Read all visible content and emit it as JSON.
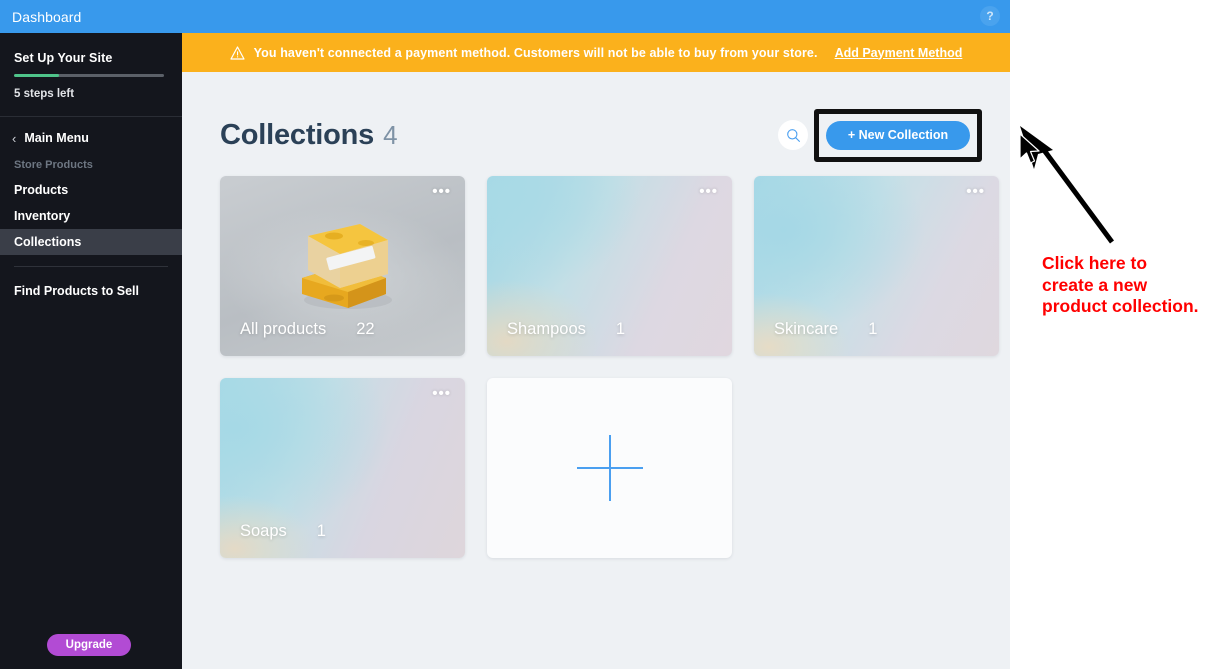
{
  "topbar": {
    "title": "Dashboard",
    "help_icon": "question-mark-icon",
    "help_label": "?",
    "background_color": "#3899ec"
  },
  "sidebar": {
    "setup": {
      "title": "Set Up Your Site",
      "steps_left": "5 steps left",
      "progress_percent": 30,
      "progress_color": "#4fc48a"
    },
    "main_menu": {
      "label": "Main Menu",
      "back_icon": "chevron-left-icon",
      "back_glyph": "‹"
    },
    "section_label": "Store Products",
    "items": [
      {
        "label": "Products",
        "active": false
      },
      {
        "label": "Inventory",
        "active": false
      },
      {
        "label": "Collections",
        "active": true
      }
    ],
    "extra_items": [
      {
        "label": "Find Products to Sell",
        "active": false
      }
    ],
    "upgrade_label": "Upgrade",
    "upgrade_color": "#b24bd4",
    "background_color": "#14161d"
  },
  "banner": {
    "icon": "warning-triangle-icon",
    "message": "You haven't connected a payment method. Customers will not be able to buy from your store.",
    "cta_label": "Add Payment Method",
    "background_color": "#fbb11c"
  },
  "page": {
    "title": "Collections",
    "count": "4",
    "search_icon": "search-icon",
    "new_collection_label": "+ New Collection",
    "new_collection_color": "#3899ec",
    "title_color": "#2b4157"
  },
  "collections": [
    {
      "name": "All products",
      "count": "22",
      "menu_icon": "more-options-icon",
      "thumbnail": "soap-bars-photo"
    },
    {
      "name": "Shampoos",
      "count": "1",
      "menu_icon": "more-options-icon",
      "thumbnail": "gradient-placeholder"
    },
    {
      "name": "Skincare",
      "count": "1",
      "menu_icon": "more-options-icon",
      "thumbnail": "gradient-placeholder"
    },
    {
      "name": "Soaps",
      "count": "1",
      "menu_icon": "more-options-icon",
      "thumbnail": "gradient-placeholder"
    }
  ],
  "add_card": {
    "icon": "plus-icon",
    "color": "#4a9ff0"
  },
  "annotation": {
    "text": "Click here to create a new product collection.",
    "color": "#ff0000",
    "arrow_icon": "arrow-up-left-icon",
    "cursor_icon": "mouse-pointer-icon",
    "highlight_color": "#111111"
  }
}
